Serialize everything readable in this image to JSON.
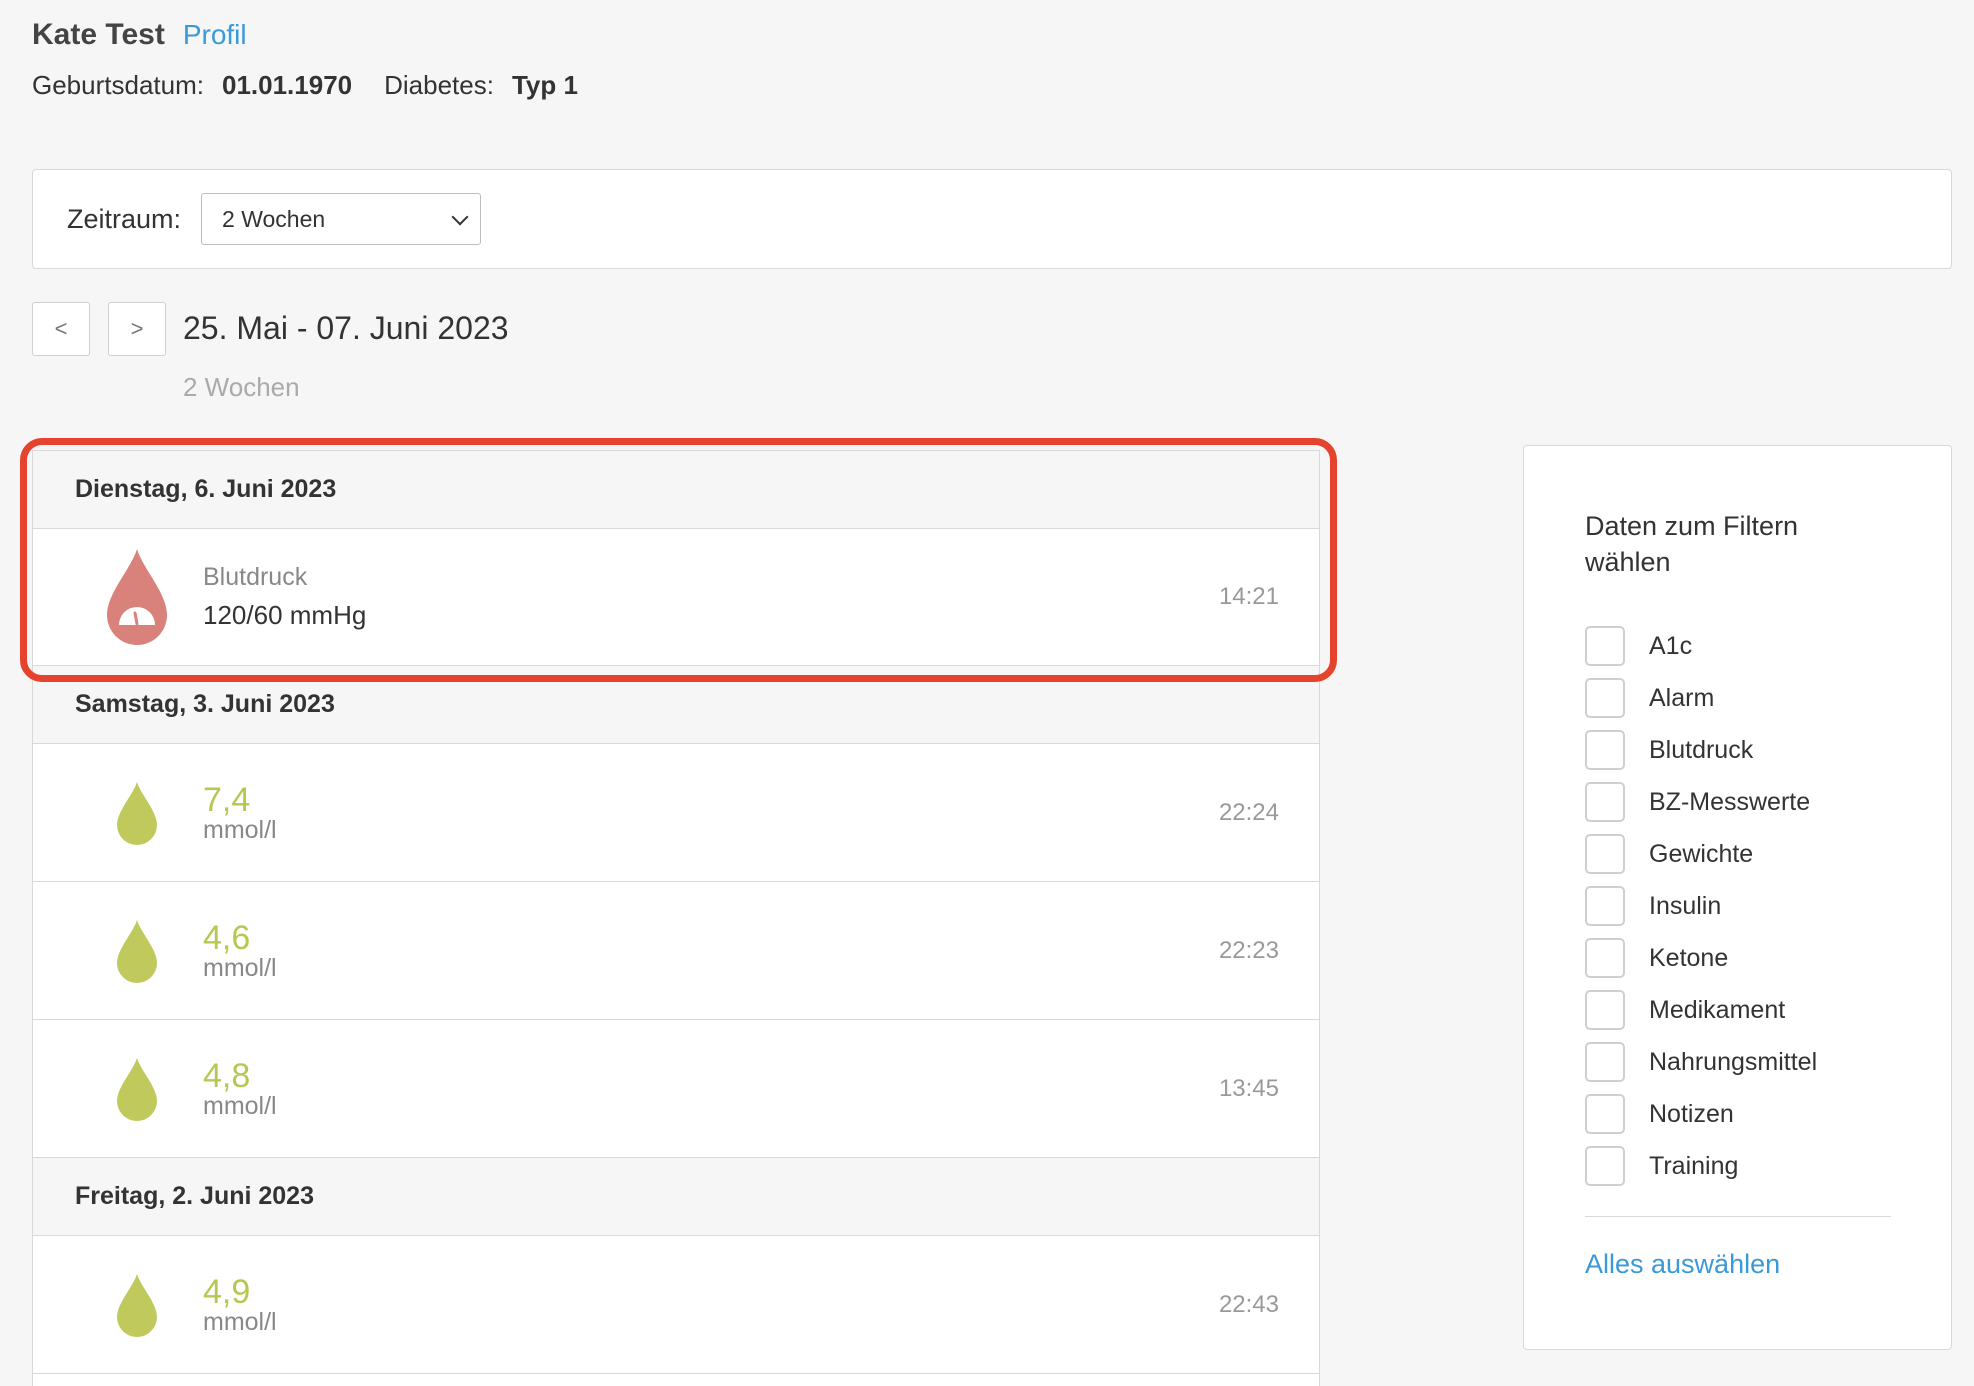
{
  "header": {
    "patient_name": "Kate Test",
    "profile_link": "Profil",
    "birthdate_label": "Geburtsdatum:",
    "birthdate_value": "01.01.1970",
    "diabetes_label": "Diabetes:",
    "diabetes_value": "Typ 1"
  },
  "timeframe": {
    "label": "Zeitraum:",
    "selected": "2 Wochen"
  },
  "date_nav": {
    "prev": "<",
    "next": ">",
    "range": "25. Mai - 07. Juni 2023",
    "period": "2 Wochen"
  },
  "days": [
    {
      "date": "Dienstag, 6. Juni 2023",
      "entries": [
        {
          "kind": "blood-pressure",
          "type": "Blutdruck",
          "value": "120/60 mmHg",
          "time": "14:21"
        }
      ]
    },
    {
      "date": "Samstag, 3. Juni 2023",
      "entries": [
        {
          "kind": "glucose",
          "value": "7,4",
          "unit": "mmol/l",
          "time": "22:24"
        },
        {
          "kind": "glucose",
          "value": "4,6",
          "unit": "mmol/l",
          "time": "22:23"
        },
        {
          "kind": "glucose",
          "value": "4,8",
          "unit": "mmol/l",
          "time": "13:45"
        }
      ]
    },
    {
      "date": "Freitag, 2. Juni 2023",
      "entries": [
        {
          "kind": "glucose",
          "value": "4,9",
          "unit": "mmol/l",
          "time": "22:43"
        }
      ]
    }
  ],
  "filter": {
    "title": "Daten zum Filtern wählen",
    "options": [
      "A1c",
      "Alarm",
      "Blutdruck",
      "BZ-Messwerte",
      "Gewichte",
      "Insulin",
      "Ketone",
      "Medikament",
      "Nahrungsmittel",
      "Notizen",
      "Training"
    ],
    "select_all": "Alles auswählen"
  },
  "colors": {
    "accent": "#3a9ad9",
    "glucose": "#b8c752",
    "blood_pressure": "#d9827c",
    "highlight": "#e5432d"
  },
  "icons": {
    "blood_pressure": "blood-pressure-drop-icon",
    "glucose": "glucose-drop-icon"
  }
}
